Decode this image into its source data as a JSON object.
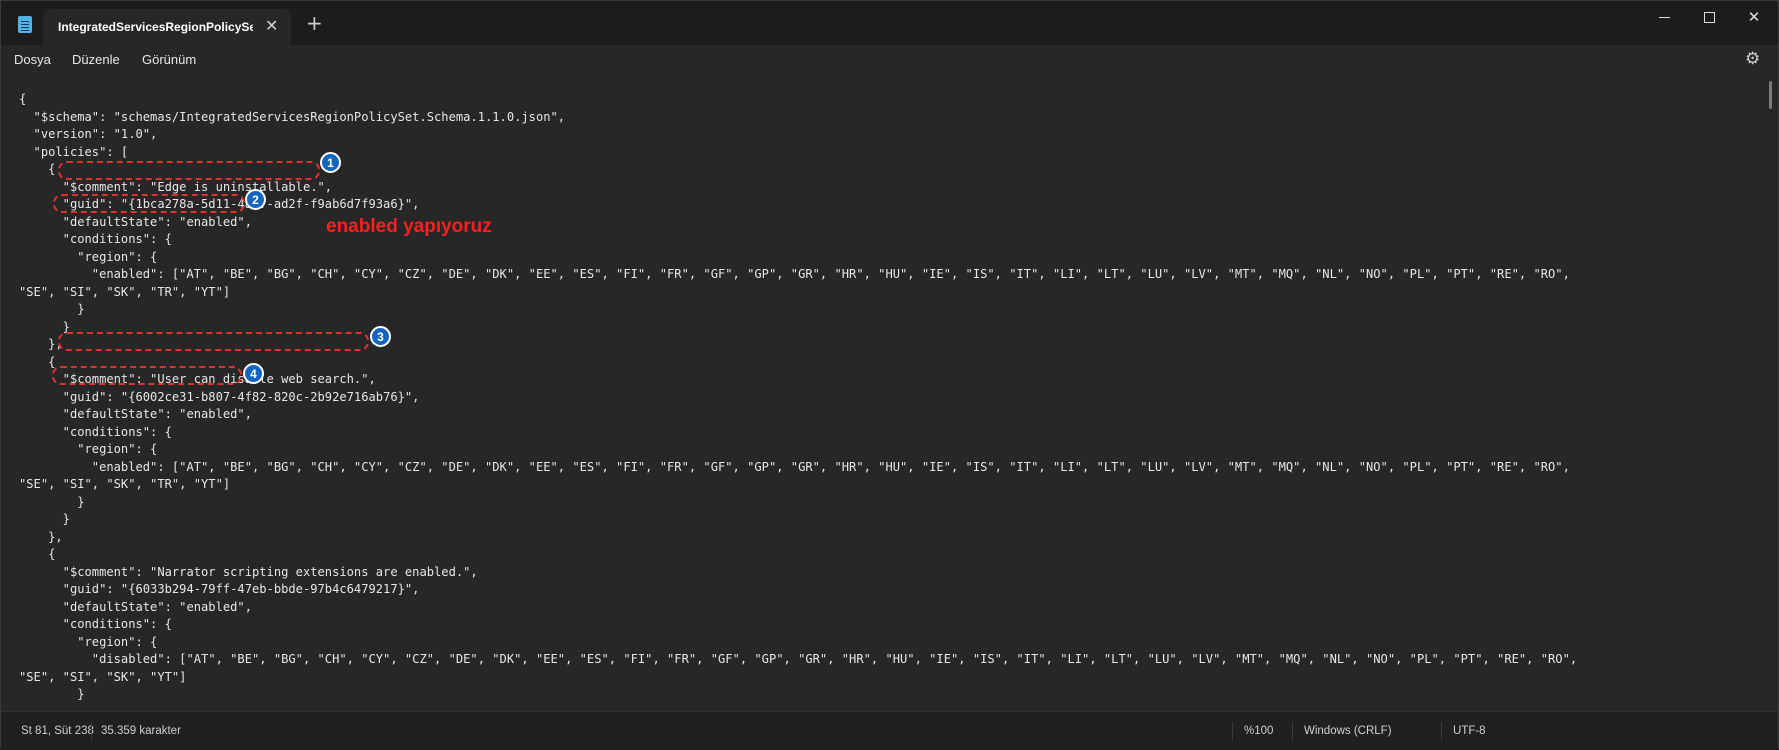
{
  "tab": {
    "title": "IntegratedServicesRegionPolicySet",
    "close_glyph": "✕",
    "new_tab_glyph": "+"
  },
  "menu": {
    "items": [
      "Dosya",
      "Düzenle",
      "Görünüm"
    ]
  },
  "icons": {
    "app": "notepad-icon",
    "settings": "gear-icon",
    "close": "close-icon"
  },
  "editor": {
    "lines": [
      "{",
      "  \"$schema\": \"schemas/IntegratedServicesRegionPolicySet.Schema.1.1.0.json\",",
      "  \"version\": \"1.0\",",
      "  \"policies\": [",
      "    {",
      "      \"$comment\": \"Edge is uninstallable.\",",
      "      \"guid\": \"{1bca278a-5d11-4acf-ad2f-f9ab6d7f93a6}\",",
      "      \"defaultState\": \"enabled\",",
      "      \"conditions\": {",
      "        \"region\": {",
      "          \"enabled\": [\"AT\", \"BE\", \"BG\", \"CH\", \"CY\", \"CZ\", \"DE\", \"DK\", \"EE\", \"ES\", \"FI\", \"FR\", \"GF\", \"GP\", \"GR\", \"HR\", \"HU\", \"IE\", \"IS\", \"IT\", \"LI\", \"LT\", \"LU\", \"LV\", \"MT\", \"MQ\", \"NL\", \"NO\", \"PL\", \"PT\", \"RE\", \"RO\",",
      "\"SE\", \"SI\", \"SK\", \"TR\", \"YT\"]",
      "        }",
      "      }",
      "    },",
      "    {",
      "      \"$comment\": \"User can disable web search.\",",
      "      \"guid\": \"{6002ce31-b807-4f82-820c-2b92e716ab76}\",",
      "      \"defaultState\": \"enabled\",",
      "      \"conditions\": {",
      "        \"region\": {",
      "          \"enabled\": [\"AT\", \"BE\", \"BG\", \"CH\", \"CY\", \"CZ\", \"DE\", \"DK\", \"EE\", \"ES\", \"FI\", \"FR\", \"GF\", \"GP\", \"GR\", \"HR\", \"HU\", \"IE\", \"IS\", \"IT\", \"LI\", \"LT\", \"LU\", \"LV\", \"MT\", \"MQ\", \"NL\", \"NO\", \"PL\", \"PT\", \"RE\", \"RO\",",
      "\"SE\", \"SI\", \"SK\", \"TR\", \"YT\"]",
      "        }",
      "      }",
      "    },",
      "    {",
      "      \"$comment\": \"Narrator scripting extensions are enabled.\",",
      "      \"guid\": \"{6033b294-79ff-47eb-bbde-97b4c6479217}\",",
      "      \"defaultState\": \"enabled\",",
      "      \"conditions\": {",
      "        \"region\": {",
      "          \"disabled\": [\"AT\", \"BE\", \"BG\", \"CH\", \"CY\", \"CZ\", \"DE\", \"DK\", \"EE\", \"ES\", \"FI\", \"FR\", \"GF\", \"GP\", \"GR\", \"HR\", \"HU\", \"IE\", \"IS\", \"IT\", \"LI\", \"LT\", \"LU\", \"LV\", \"MT\", \"MQ\", \"NL\", \"NO\", \"PL\", \"PT\", \"RE\", \"RO\",",
      "\"SE\", \"SI\", \"SK\", \"YT\"]",
      "        }"
    ]
  },
  "annotations": {
    "badges": [
      "1",
      "2",
      "3",
      "4"
    ],
    "note": "enabled yapıyoruz",
    "color": "#e0322c"
  },
  "status": {
    "position": "St 81, Süt 238",
    "chars": "35.359 karakter",
    "zoom": "%100",
    "line_endings": "Windows (CRLF)",
    "encoding": "UTF-8"
  }
}
